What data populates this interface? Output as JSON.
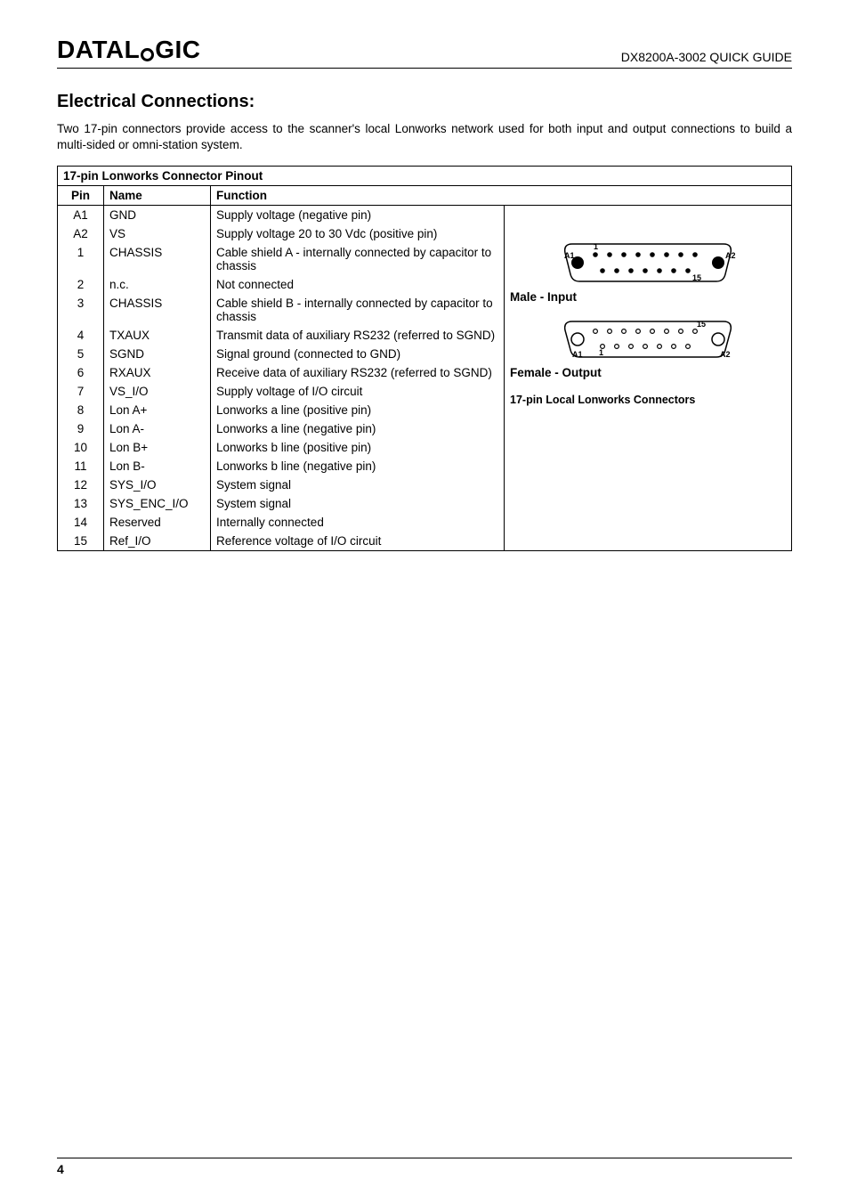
{
  "brand_prefix": "D",
  "brand_text1": "ATAL",
  "brand_text2": "GIC",
  "header_right": "DX8200A-3002 QUICK GUIDE",
  "section_title": "Electrical Connections:",
  "intro": "Two 17-pin connectors provide access to the scanner's local Lonworks network used for both input and output connections to build a multi-sided or omni-station system.",
  "table": {
    "title": "17-pin Lonworks Connector Pinout",
    "headers": {
      "pin": "Pin",
      "name": "Name",
      "function": "Function"
    },
    "rows": [
      {
        "pin": "A1",
        "name": "GND",
        "func": "Supply voltage (negative pin)"
      },
      {
        "pin": "A2",
        "name": "VS",
        "func": "Supply voltage 20 to 30 Vdc (positive pin)"
      },
      {
        "pin": "1",
        "name": "CHASSIS",
        "func": "Cable shield A - internally connected by capacitor to chassis"
      },
      {
        "pin": "2",
        "name": "n.c.",
        "func": "Not connected"
      },
      {
        "pin": "3",
        "name": "CHASSIS",
        "func": "Cable shield B - internally connected by capacitor to chassis"
      },
      {
        "pin": "4",
        "name": "TXAUX",
        "func": "Transmit data of auxiliary RS232 (referred to SGND)"
      },
      {
        "pin": "5",
        "name": "SGND",
        "func": "Signal ground (connected to GND)"
      },
      {
        "pin": "6",
        "name": "RXAUX",
        "func": "Receive data of auxiliary RS232 (referred to SGND)"
      },
      {
        "pin": "7",
        "name": "VS_I/O",
        "func": "Supply voltage of I/O circuit"
      },
      {
        "pin": "8",
        "name": "Lon A+",
        "func": "Lonworks a line (positive pin)"
      },
      {
        "pin": "9",
        "name": "Lon A-",
        "func": "Lonworks a line (negative pin)"
      },
      {
        "pin": "10",
        "name": "Lon B+",
        "func": "Lonworks b line (positive pin)"
      },
      {
        "pin": "11",
        "name": "Lon B-",
        "func": "Lonworks b line (negative pin)"
      },
      {
        "pin": "12",
        "name": "SYS_I/O",
        "func": "System signal"
      },
      {
        "pin": "13",
        "name": "SYS_ENC_I/O",
        "func": "System signal"
      },
      {
        "pin": "14",
        "name": "Reserved",
        "func": "Internally connected"
      },
      {
        "pin": "15",
        "name": "Ref_I/O",
        "func": "Reference voltage of I/O circuit"
      }
    ],
    "diagram": {
      "male_label": "Male - Input",
      "female_label": "Female - Output",
      "sub_label": "17-pin Local Lonworks Connectors",
      "pins_A1": "A1",
      "pins_A2": "A2",
      "pins_1": "1",
      "pins_15": "15"
    }
  },
  "page_number": "4"
}
